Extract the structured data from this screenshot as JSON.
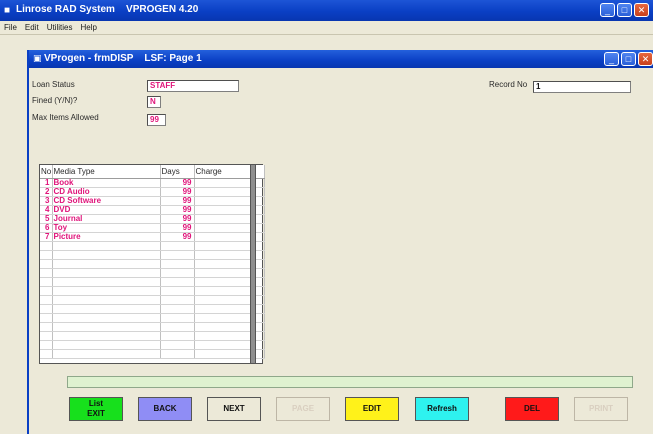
{
  "app": {
    "title": "Linrose RAD System    VPROGEN 4.20"
  },
  "menu": [
    "File",
    "Edit",
    "Utilities",
    "Help"
  ],
  "window": {
    "title": "VProgen - frmDISP    LSF: Page 1"
  },
  "form": {
    "loan_status_label": "Loan Status",
    "loan_status_value": "STAFF",
    "fined_label": "Fined (Y/N)?",
    "fined_value": "N",
    "max_items_label": "Max Items Allowed",
    "max_items_value": "99",
    "record_no_label": "Record No",
    "record_no_value": "1"
  },
  "grid": {
    "columns": [
      "No",
      "Media Type",
      "Days",
      "Charge"
    ],
    "rows": [
      {
        "no": "1",
        "media": "Book",
        "days": "99",
        "charge": ""
      },
      {
        "no": "2",
        "media": "CD Audio",
        "days": "99",
        "charge": ""
      },
      {
        "no": "3",
        "media": "CD Software",
        "days": "99",
        "charge": ""
      },
      {
        "no": "4",
        "media": "DVD",
        "days": "99",
        "charge": ""
      },
      {
        "no": "5",
        "media": "Journal",
        "days": "99",
        "charge": ""
      },
      {
        "no": "6",
        "media": "Toy",
        "days": "99",
        "charge": ""
      },
      {
        "no": "7",
        "media": "Picture",
        "days": "99",
        "charge": ""
      }
    ],
    "empty_rows": 13
  },
  "buttons": {
    "exit_line1": "List",
    "exit_line2": "EXIT",
    "back": "BACK",
    "next": "NEXT",
    "page": "PAGE",
    "edit": "EDIT",
    "refresh": "Refresh",
    "del": "DEL",
    "print": "PRINT"
  },
  "colors": {
    "exit": "#17e01c",
    "back": "#8f8df5",
    "next": "#ece9d8",
    "page": "#ece9d8",
    "edit": "#fff21a",
    "refresh": "#2ef2ef",
    "del": "#ff1a1a",
    "print": "#ece9d8",
    "field_text": "#e0147a"
  }
}
